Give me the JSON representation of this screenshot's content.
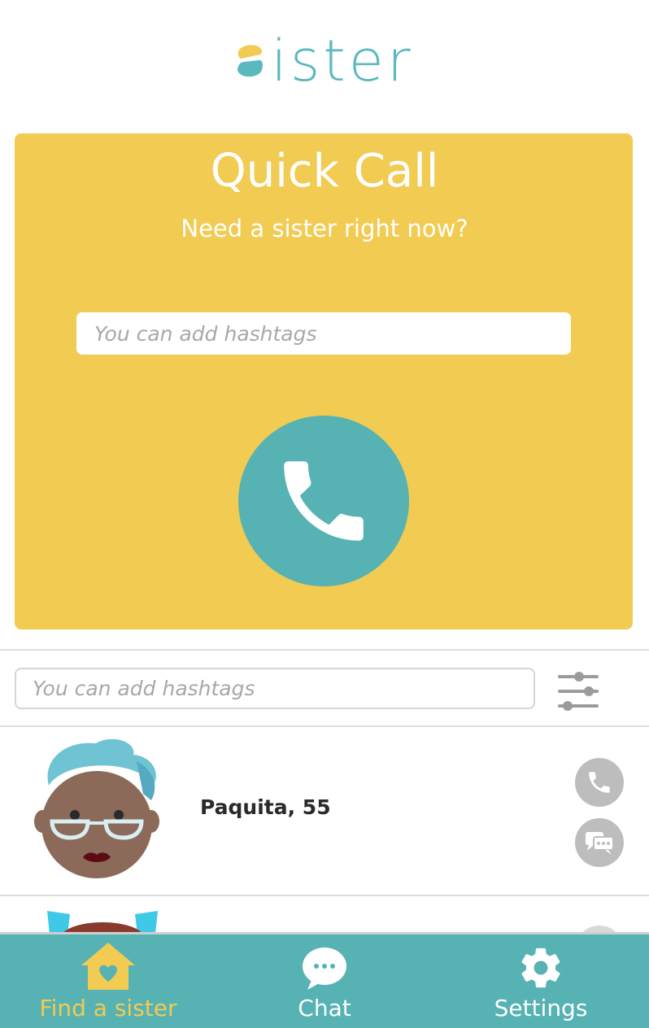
{
  "header": {
    "logo_text": "ister"
  },
  "quick_call": {
    "title": "Quick Call",
    "subtitle": "Need a sister right now?",
    "hashtag_placeholder": "You can add hashtags"
  },
  "search": {
    "placeholder": "You can add hashtags"
  },
  "sisters": [
    {
      "name": "Paquita, 55"
    }
  ],
  "nav": [
    {
      "label": "Find a sister",
      "icon": "home-heart-icon",
      "active": true
    },
    {
      "label": "Chat",
      "icon": "chat-bubble-icon",
      "active": false
    },
    {
      "label": "Settings",
      "icon": "gear-icon",
      "active": false
    }
  ],
  "colors": {
    "accent_yellow": "#f2cb52",
    "accent_teal": "#56b2b3",
    "icon_gray": "#bdbdbd"
  }
}
